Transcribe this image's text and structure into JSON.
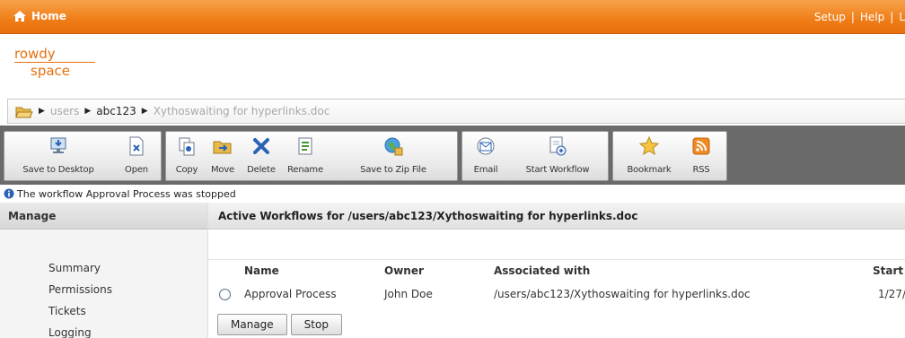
{
  "topbar": {
    "home_label": "Home",
    "links": [
      "Setup",
      "Help",
      "L"
    ]
  },
  "logo": {
    "line1": "rowdy",
    "line2": "space"
  },
  "breadcrumb": [
    {
      "label": "users",
      "style": "gray"
    },
    {
      "label": "abc123",
      "style": "dark"
    },
    {
      "label": "Xythoswaiting for hyperlinks.doc",
      "style": "gray"
    }
  ],
  "toolbar": {
    "save_desktop": "Save to Desktop",
    "open": "Open",
    "copy": "Copy",
    "move": "Move",
    "delete": "Delete",
    "rename": "Rename",
    "save_zip": "Save to Zip File",
    "email": "Email",
    "start_workflow": "Start Workflow",
    "bookmark": "Bookmark",
    "rss": "RSS"
  },
  "status_message": "The workflow Approval Process was stopped",
  "sidebar": {
    "title": "Manage",
    "items": [
      "Summary",
      "Permissions",
      "Tickets",
      "Logging"
    ]
  },
  "main": {
    "title": "Active Workflows for /users/abc123/Xythoswaiting for hyperlinks.doc",
    "columns": [
      "Name",
      "Owner",
      "Associated with",
      "Start"
    ],
    "rows": [
      {
        "name": "Approval Process",
        "owner": "John Doe",
        "associated": "/users/abc123/Xythoswaiting for hyperlinks.doc",
        "start": "1/27/"
      }
    ],
    "buttons": {
      "manage": "Manage",
      "stop": "Stop"
    }
  },
  "colors": {
    "brand_orange": "#ef7d17",
    "toolbar_bg": "#6a6a6a"
  },
  "icons": {
    "home": "house-icon",
    "folder": "open-folder-icon",
    "info": "info-icon"
  }
}
